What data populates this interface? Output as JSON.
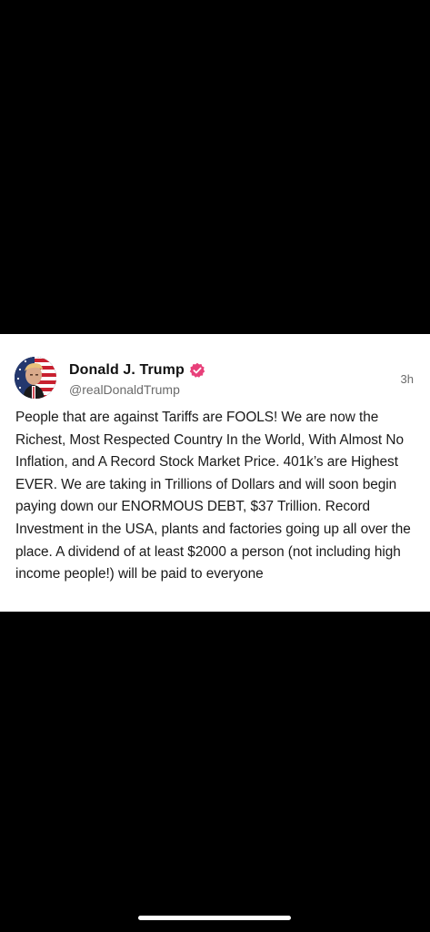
{
  "post": {
    "display_name": "Donald J. Trump",
    "handle": "@realDonaldTrump",
    "time": "3h",
    "verified": true,
    "body": "People that are against Tariffs are FOOLS! We are now the Richest, Most Respected Country In the World, With Almost No Inflation, and A Record Stock Market Price. 401k’s are Highest EVER. We are taking in Trillions of Dollars and will soon begin paying down our ENORMOUS DEBT, $37 Trillion. Record Investment in the USA, plants and factories going up all over the place. A dividend of at least $2000 a person (not including high income people!) will be paid to everyone"
  },
  "colors": {
    "background": "#000000",
    "card": "#ffffff",
    "verified_badge": "#e8407a",
    "secondary_text": "#6b6b6b"
  }
}
